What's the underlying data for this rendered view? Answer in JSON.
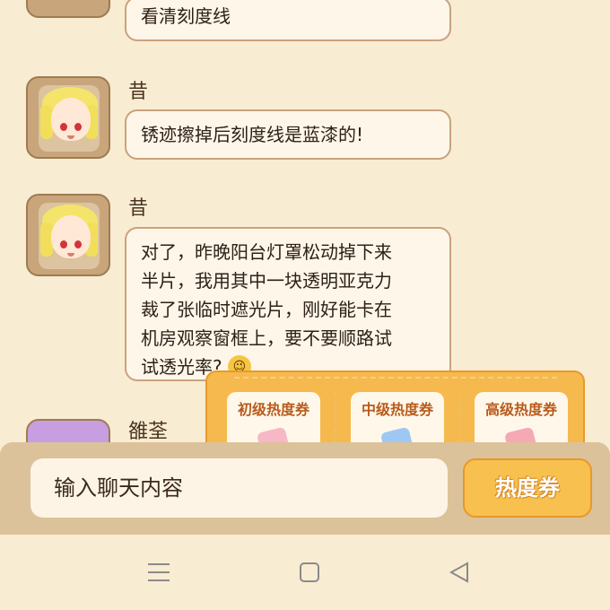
{
  "messages": [
    {
      "sender": "",
      "text_lines": [
        "看清刻度线"
      ]
    },
    {
      "sender": "昔",
      "text_lines": [
        "锈迹擦掉后刻度线是蓝漆的!"
      ]
    },
    {
      "sender": "昔",
      "text_lines": [
        "对了，昨晚阳台灯罩松动掉下来",
        "半片，我用其中一块透明亚克力",
        "裁了张临时遮光片，刚好能卡在",
        "机房观察窗框上，要不要顺路试",
        "试透光率?"
      ],
      "emoji": "wink-emoji"
    },
    {
      "sender": "雒荃"
    }
  ],
  "tickets": [
    {
      "label": "初级热度券",
      "color": "#f7b7c6"
    },
    {
      "label": "中级热度券",
      "color": "#9ec8f4"
    },
    {
      "label": "高级热度券",
      "color": "#f6a8b4"
    }
  ],
  "input": {
    "placeholder": "输入聊天内容"
  },
  "ticket_button": {
    "label": "热度券"
  },
  "nav": {
    "menu_icon": "menu-icon",
    "home_icon": "square-icon",
    "back_icon": "back-triangle-icon"
  },
  "colors": {
    "background": "#f8ecd2",
    "accent": "#f8c04f",
    "bubble": "#fff6ea"
  }
}
